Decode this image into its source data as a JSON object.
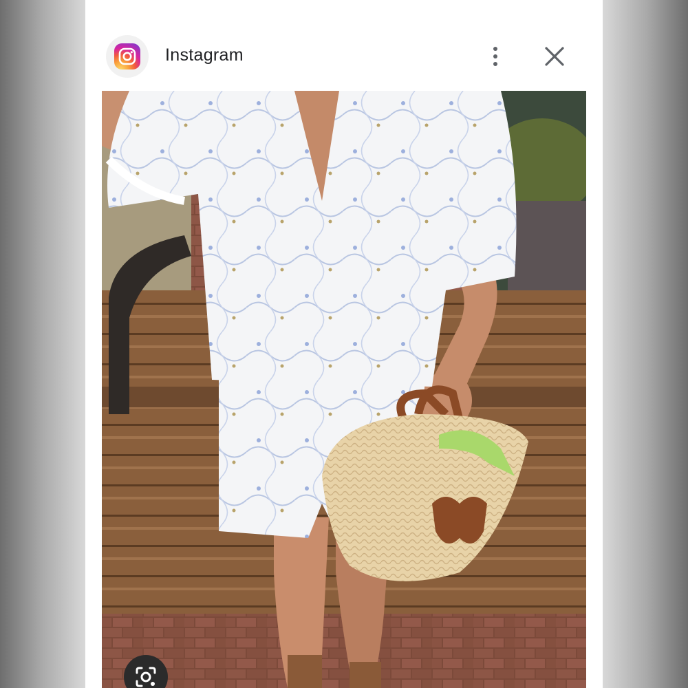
{
  "header": {
    "app_name": "Instagram",
    "more_options_icon": "more-vert-icon",
    "close_icon": "close-icon"
  },
  "photo": {
    "visual_search_icon": "google-lens-icon"
  },
  "colors": {
    "sheet_background": "#ffffff",
    "title_text": "#202124",
    "icon_gray": "#5f6368",
    "lens_button_bg": "#2b2b2b"
  }
}
